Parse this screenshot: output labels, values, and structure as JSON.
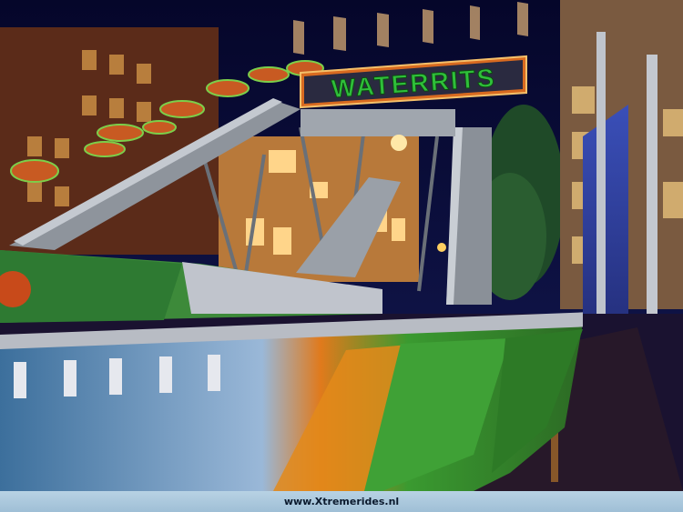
{
  "ride_sign": {
    "text": "WATERRITS"
  },
  "watermark": {
    "text": "www.Xtremerides.nl"
  },
  "colors": {
    "sky": "#0a0a3a",
    "sign_letters": "#2fbf3a",
    "sign_frame": "#d86a20",
    "lights": "#ffd080"
  }
}
